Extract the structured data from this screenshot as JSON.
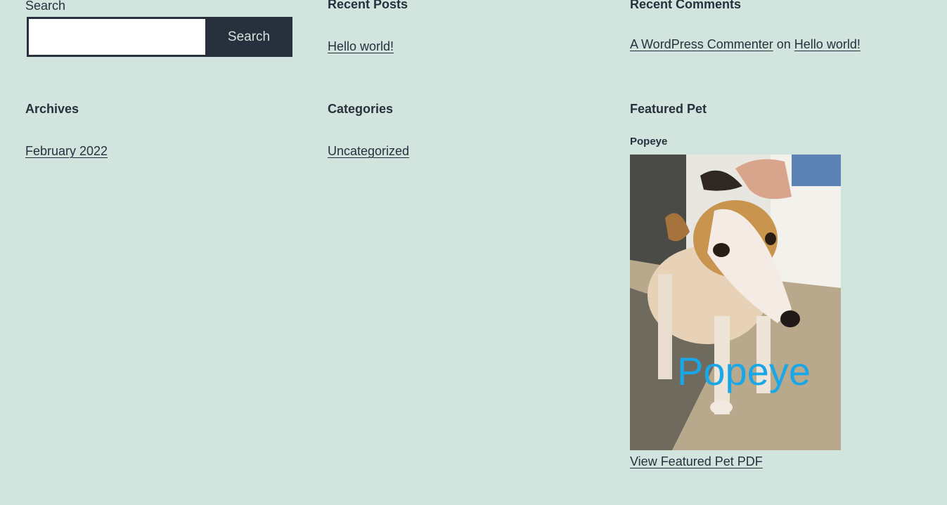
{
  "search": {
    "label": "Search",
    "placeholder": "",
    "value": "",
    "button_label": "Search"
  },
  "recent_posts": {
    "title": "Recent Posts",
    "items": [
      "Hello world!"
    ]
  },
  "recent_comments": {
    "title": "Recent Comments",
    "author": "A WordPress Commenter",
    "connector": "on",
    "post": "Hello world!"
  },
  "archives": {
    "title": "Archives",
    "items": [
      "February 2022"
    ]
  },
  "categories": {
    "title": "Categories",
    "items": [
      "Uncategorized"
    ]
  },
  "featured_pet": {
    "title": "Featured Pet",
    "name": "Popeye",
    "image_caption": "Popeye",
    "pdf_link": "View Featured Pet PDF"
  },
  "colors": {
    "background": "#d1e4dd",
    "text": "#28303d",
    "caption": "#1aa7e8"
  }
}
